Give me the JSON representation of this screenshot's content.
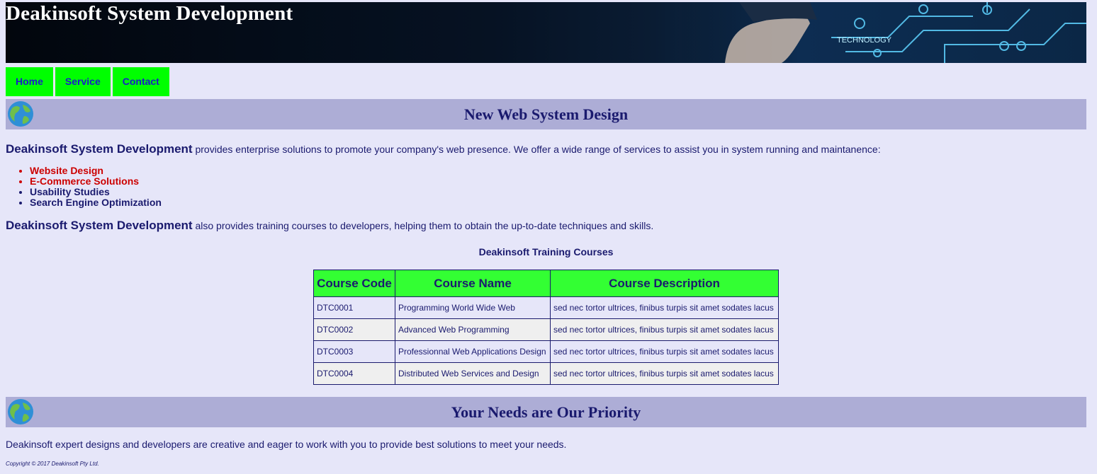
{
  "header": {
    "title": "Deakinsoft System Development",
    "banner_word": "TECHNOLOGY"
  },
  "nav": [
    "Home",
    "Service",
    "Contact"
  ],
  "section1": {
    "heading": "New Web System Design",
    "intro_strong": "Deakinsoft System Development",
    "intro_rest": " provides enterprise solutions to promote your company's web presence. We offer a wide range of services to assist you in system running and maintanence:",
    "services": [
      {
        "label": "Website Design",
        "color": "#cc0000"
      },
      {
        "label": "E-Commerce Solutions",
        "color": "#cc0000"
      },
      {
        "label": "Usability Studies",
        "color": "#1a1a6e"
      },
      {
        "label": "Search Engine Optimization",
        "color": "#1a1a6e"
      }
    ],
    "training_strong": "Deakinsoft System Development",
    "training_rest": " also provides training courses to developers, helping them to obtain the up-to-date techniques and skills."
  },
  "table": {
    "caption": "Deakinsoft Training Courses",
    "headers": [
      "Course Code",
      "Course Name",
      "Course Description"
    ],
    "rows": [
      [
        "DTC0001",
        "Programming World Wide Web",
        "sed nec tortor ultrices, finibus turpis sit amet sodates lacus"
      ],
      [
        "DTC0002",
        "Advanced Web Programming",
        "sed nec tortor ultrices, finibus turpis sit amet sodates lacus"
      ],
      [
        "DTC0003",
        "Professionnal Web Applications Design",
        "sed nec tortor ultrices, finibus turpis sit amet sodates lacus"
      ],
      [
        "DTC0004",
        "Distributed Web Services and Design",
        "sed nec tortor ultrices, finibus turpis sit amet sodates lacus"
      ]
    ]
  },
  "section2": {
    "heading": "Your Needs are Our Priority",
    "text": "Deakinsoft expert designs and developers are creative and eager to work with you to provide best solutions to meet your needs."
  },
  "footer": {
    "copyright": "Copyright © 2017 Deakinsoft Pty Ltd."
  },
  "colors": {
    "page_bg": "#e6e6f9",
    "nav_bg": "#00ff00",
    "heading_bar": "#adadd6",
    "table_header": "#33ff33",
    "text": "#1a1a6e"
  }
}
